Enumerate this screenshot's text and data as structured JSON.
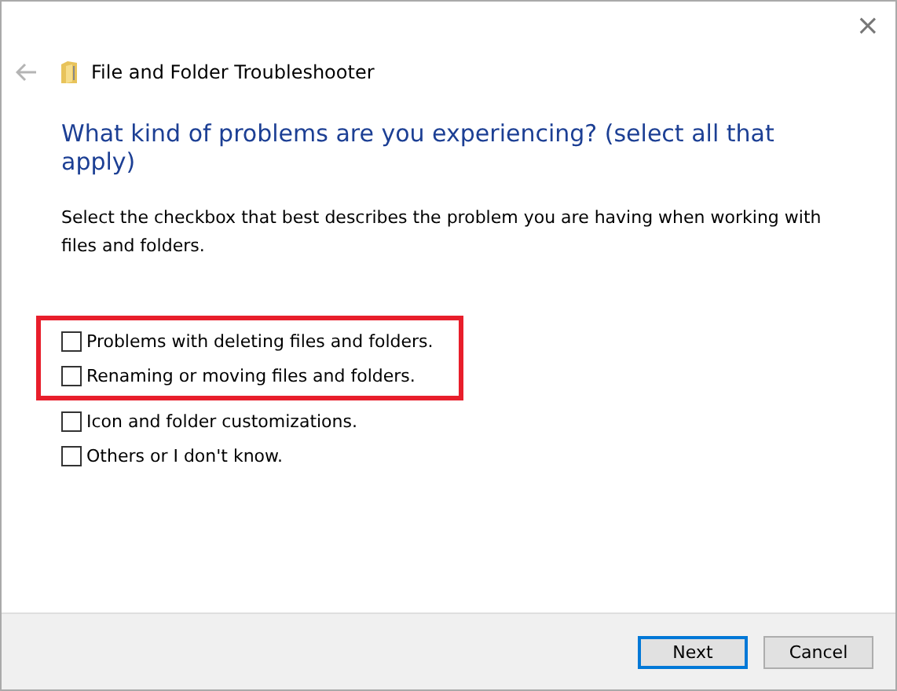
{
  "window": {
    "title": "File and Folder Troubleshooter",
    "close": "×"
  },
  "heading": "What kind of problems are you experiencing? (select all that apply)",
  "description": "Select the checkbox that best describes the problem you are having when working with files and folders.",
  "options": [
    {
      "label": "Problems with deleting files and folders.",
      "checked": false,
      "highlighted": true
    },
    {
      "label": "Renaming or moving files and folders.",
      "checked": false,
      "highlighted": true
    },
    {
      "label": "Icon and folder customizations.",
      "checked": false,
      "highlighted": false
    },
    {
      "label": "Others or I don't know.",
      "checked": false,
      "highlighted": false
    }
  ],
  "buttons": [
    {
      "label": "Next",
      "kind": "default"
    },
    {
      "label": "Cancel",
      "kind": "normal"
    }
  ]
}
